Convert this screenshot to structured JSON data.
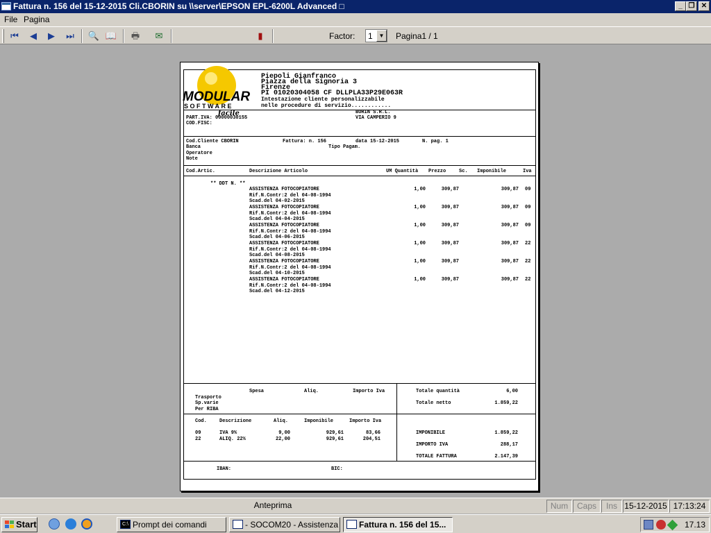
{
  "window": {
    "title": "Fattura n.  156 del 15-12-2015 Cli.CBORIN su \\\\server\\EPSON EPL-6200L Advanced",
    "title_glyph": "□"
  },
  "menu": [
    "File",
    "Pagina"
  ],
  "toolbar": {
    "buttons": [
      "first-page-icon",
      "prev-page-icon",
      "next-page-icon",
      "last-page-icon",
      "zoom-icon",
      "book-icon",
      "printer-icon",
      "export-icon",
      "exit-door-icon"
    ],
    "factor_label": "Factor:",
    "factor_value": "1",
    "page_label": "Pagina1 / 1"
  },
  "invoice": {
    "logo": {
      "brand": "MODULAR",
      "sub": "SOFTWARE",
      "tag": "facile"
    },
    "customer": {
      "name": "Piepoli Gianfranco",
      "address": "Piazza della Signoria 3",
      "city": "Firenze",
      "tax_line": "PI 01020304058  CF DLLPLA33P29E063R",
      "note1": "Intestazione cliente personalizzabile",
      "note2": "nelle procedure di servizio............"
    },
    "company": {
      "piva_label": "PART.IVA:",
      "piva": "00000030155",
      "codfisc_label": "COD.FISC:",
      "name": "BORIN S.R.L.",
      "street": "VIA CAMPERIO 9"
    },
    "meta": {
      "cod_cliente": "Cod.Cliente CBORIN",
      "fattura": "Fattura: n.   156",
      "data": "data 15-12-2015",
      "npag": "N. pag.   1",
      "banca": "Banca",
      "tipo_pagam": "Tipo Pagam.",
      "operatore": "Operatore",
      "note": "Note"
    },
    "columns": {
      "cod": "Cod.Artic.",
      "desc": "Descrizione Articolo",
      "um_qty": "UM Quantità",
      "prezzo": "Prezzo",
      "sc": "Sc.",
      "imponibile": "Imponibile",
      "iva": "Iva"
    },
    "ddt_label": "** DDT N. **",
    "rows": [
      {
        "desc": "ASSISTENZA FOTOCOPIATORE",
        "rif": "Rif.N.Contr:2 del 04-08-1994",
        "scad": "Scad.del 04-02-2015",
        "qty": "1,00",
        "price": "309,87",
        "amount": "309,87",
        "iva": "09"
      },
      {
        "desc": "ASSISTENZA FOTOCOPIATORE",
        "rif": "Rif.N.Contr:2 del 04-08-1994",
        "scad": "Scad.del 04-04-2015",
        "qty": "1,00",
        "price": "309,87",
        "amount": "309,87",
        "iva": "09"
      },
      {
        "desc": "ASSISTENZA FOTOCOPIATORE",
        "rif": "Rif.N.Contr:2 del 04-08-1994",
        "scad": "Scad.del 04-06-2015",
        "qty": "1,00",
        "price": "309,87",
        "amount": "309,87",
        "iva": "09"
      },
      {
        "desc": "ASSISTENZA FOTOCOPIATORE",
        "rif": "Rif.N.Contr:2 del 04-08-1994",
        "scad": "Scad.del 04-08-2015",
        "qty": "1,00",
        "price": "309,87",
        "amount": "309,87",
        "iva": "22"
      },
      {
        "desc": "ASSISTENZA FOTOCOPIATORE",
        "rif": "Rif.N.Contr:2 del 04-08-1994",
        "scad": "Scad.del 04-10-2015",
        "qty": "1,00",
        "price": "309,87",
        "amount": "309,87",
        "iva": "22"
      },
      {
        "desc": "ASSISTENZA FOTOCOPIATORE",
        "rif": "Rif.N.Contr:2 del 04-08-1994",
        "scad": "Scad.del 04-12-2015",
        "qty": "1,00",
        "price": "309,87",
        "amount": "309,87",
        "iva": "22"
      }
    ],
    "expenses": {
      "spesa": "Spesa",
      "aliq": "Aliq.",
      "importo_iva": "Importo Iva",
      "trasporto": "Trasporto",
      "sp_varie": "Sp.varie",
      "per_riba": "Per RIBA"
    },
    "vat_cols": {
      "cod": "Cod.",
      "desc": "Descrizione",
      "aliq": "Aliq.",
      "imponibile": "Imponibile",
      "importo": "Importo Iva"
    },
    "vat_rows": [
      {
        "cod": "09",
        "desc": "IVA 9%",
        "aliq": "9,00",
        "imponibile": "929,61",
        "importo": "83,66"
      },
      {
        "cod": "22",
        "desc": "ALIQ. 22%",
        "aliq": "22,00",
        "imponibile": "929,61",
        "importo": "204,51"
      }
    ],
    "totals": {
      "quantita_label": "Totale quantità",
      "quantita": "6,00",
      "netto_label": "Totale netto",
      "netto": "1.859,22",
      "imponibile_label": "IMPONIBILE",
      "imponibile": "1.859,22",
      "importo_iva_label": "IMPORTO IVA",
      "importo_iva": "288,17",
      "totale_label": "TOTALE FATTURA",
      "totale": "2.147,39"
    },
    "iban_label": "IBAN:",
    "bic_label": "BIC:"
  },
  "statusbar": {
    "mode": "Anteprima",
    "num": "Num",
    "caps": "Caps",
    "ins": "Ins",
    "date": "15-12-2015",
    "time": "17:13:24"
  },
  "taskbar": {
    "start": "Start",
    "tasks": [
      {
        "label": "Prompt dei comandi",
        "active": false
      },
      {
        "label": "- SOCOM20 - Assistenza ...",
        "active": false
      },
      {
        "label": "Fattura n.  156 del 15...",
        "active": true
      }
    ],
    "clock": "17.13"
  },
  "colors": {
    "titlebar": "#0a246a",
    "chrome": "#d4d0c8",
    "desktop": "#ababab",
    "logo_yellow": "#f5c800"
  }
}
